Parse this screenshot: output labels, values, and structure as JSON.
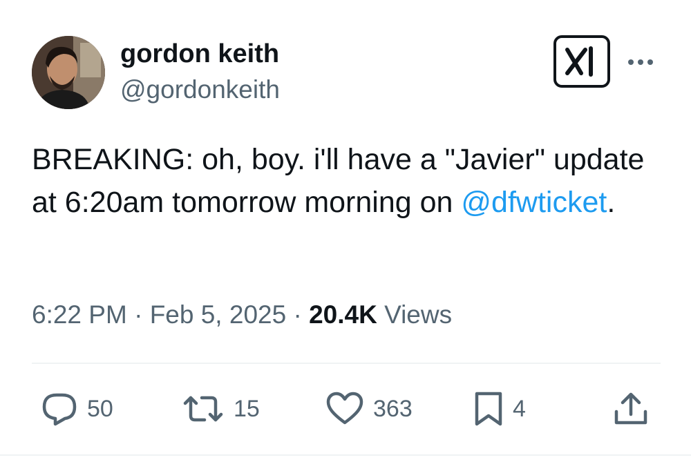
{
  "author": {
    "display_name": "gordon keith",
    "handle": "@gordonkeith"
  },
  "tweet": {
    "text_before": "BREAKING: oh, boy. i'll have a \"Javier\" update at 6:20am tomorrow morning on ",
    "mention": "@dfwticket",
    "text_after": "."
  },
  "meta": {
    "time": "6:22 PM",
    "separator": "·",
    "date": "Feb 5, 2025",
    "views_count": "20.4K",
    "views_label": "Views"
  },
  "actions": {
    "replies": "50",
    "retweets": "15",
    "likes": "363",
    "bookmarks": "4"
  },
  "icons": {
    "grok": "grok-icon",
    "more": "more-horizontal-icon",
    "reply": "reply-icon",
    "retweet": "retweet-icon",
    "like": "heart-icon",
    "bookmark": "bookmark-icon",
    "share": "share-icon"
  },
  "colors": {
    "text": "#0f1419",
    "secondary": "#536471",
    "link": "#1d9bf0",
    "divider": "#eff3f4"
  }
}
